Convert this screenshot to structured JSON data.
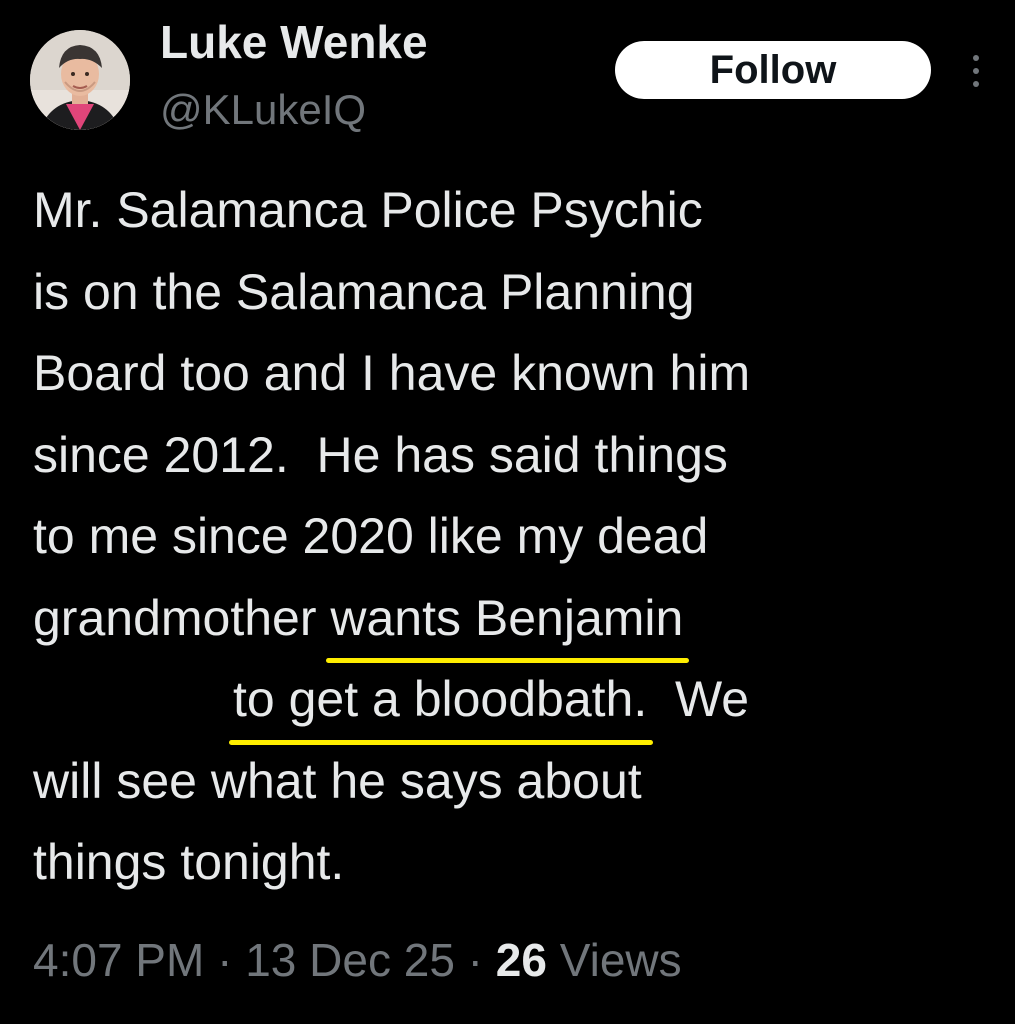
{
  "author": {
    "display_name": "Luke Wenke",
    "handle": "@KLukeIQ",
    "avatar": "profile-photo"
  },
  "actions": {
    "follow_label": "Follow",
    "more_icon": "more-vertical-icon"
  },
  "tweet": {
    "lines": [
      "Mr. Salamanca Police Psychic",
      "is on the Salamanca Planning",
      "Board too and I have known him",
      "since 2012.  He has said things",
      "to me since 2020 like my dead"
    ],
    "line6_prefix": "grandmother ",
    "line6_highlight": "wants Benjamin",
    "line7_highlight": "to get a bloodbath.",
    "line7_suffix": "  We",
    "line8": "will see what he says about",
    "line9": "things tonight.",
    "highlight_color": "#ffee00"
  },
  "meta": {
    "time": "4:07 PM",
    "separator": " · ",
    "date": "13 Dec 25",
    "views_count": "26",
    "views_label": " Views"
  },
  "colors": {
    "background": "#000000",
    "text_primary": "#e7e9ea",
    "text_secondary": "#71767b",
    "button_bg": "#ffffff",
    "button_text": "#0f1419"
  }
}
